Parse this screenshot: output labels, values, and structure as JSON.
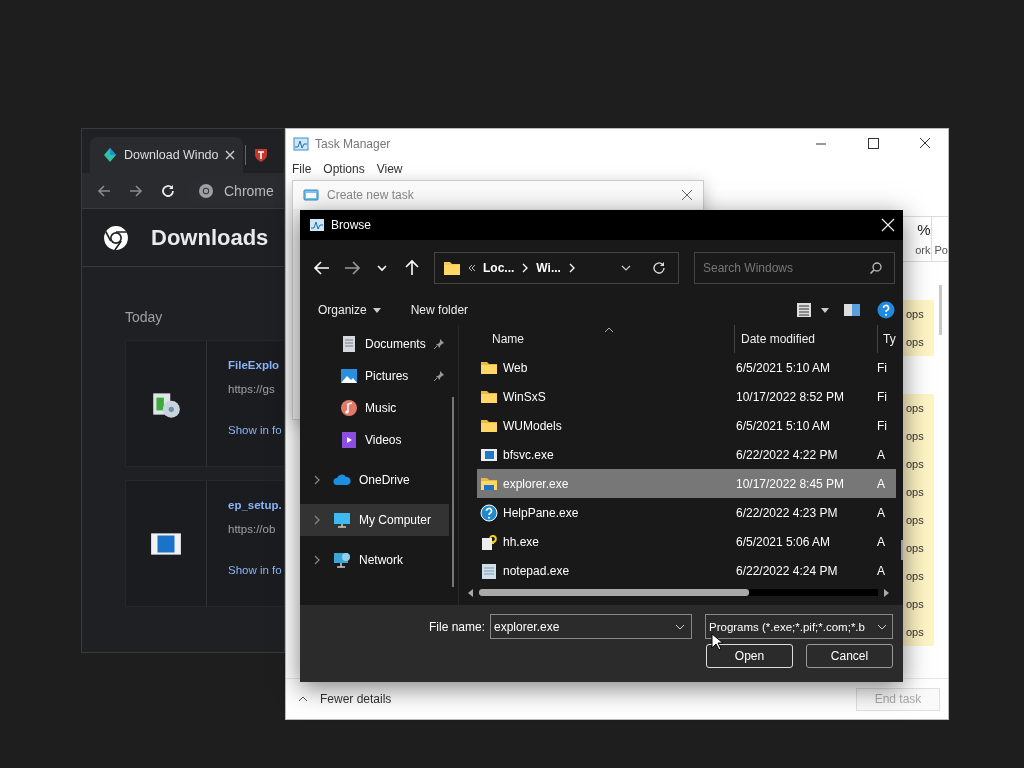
{
  "chrome": {
    "tabs": [
      {
        "title": "Download Windo",
        "selected": true
      }
    ],
    "omnibox": "Chrome",
    "page_title": "Downloads",
    "section": "Today",
    "downloads": [
      {
        "name": "FileExplo",
        "url": "https://gs",
        "action": "Show in fo",
        "kind": "installer"
      },
      {
        "name": "ep_setup.",
        "url": "https://ob",
        "action": "Show in fo",
        "kind": "app"
      }
    ]
  },
  "task_manager": {
    "title": "Task Manager",
    "menu": [
      "File",
      "Options",
      "View"
    ],
    "columns": [
      {
        "value": "%",
        "label": "ork"
      },
      {
        "label": "Po"
      }
    ],
    "groups": [
      {
        "rows": [
          "ops",
          "ops"
        ]
      },
      {
        "rows": [
          "ops",
          "ops",
          "ops",
          "ops",
          "ops",
          "ops",
          "ops",
          "ops",
          "ops"
        ]
      }
    ],
    "fewer_details": "Fewer details",
    "end_task": {
      "label": "End task",
      "disabled": true
    }
  },
  "create_task": {
    "title": "Create new task"
  },
  "browse": {
    "title": "Browse",
    "breadcrumb": [
      "Loc...",
      "Wi..."
    ],
    "search": {
      "placeholder": "Search Windows"
    },
    "commands": [
      "Organize",
      "New folder"
    ],
    "nav": [
      {
        "label": "Documents",
        "kind": "documents",
        "pinned": true,
        "selected": false
      },
      {
        "label": "Pictures",
        "kind": "pictures",
        "pinned": true,
        "selected": false
      },
      {
        "label": "Music",
        "kind": "music",
        "pinned": false,
        "selected": false
      },
      {
        "label": "Videos",
        "kind": "videos",
        "pinned": false,
        "selected": false
      },
      {
        "label": "OneDrive",
        "kind": "cloud",
        "pinned": false,
        "selected": false
      },
      {
        "label": "My Computer",
        "kind": "computer",
        "pinned": false,
        "selected": true
      },
      {
        "label": "Network",
        "kind": "network",
        "pinned": false,
        "selected": false
      }
    ],
    "columns": [
      "Name",
      "Date modified",
      "Ty"
    ],
    "files": [
      {
        "name": "Web",
        "date": "6/5/2021 5:10 AM",
        "type": "Fi",
        "kind": "folder",
        "selected": false
      },
      {
        "name": "WinSxS",
        "date": "10/17/2022 8:52 PM",
        "type": "Fi",
        "kind": "folder",
        "selected": false
      },
      {
        "name": "WUModels",
        "date": "6/5/2021 5:10 AM",
        "type": "Fi",
        "kind": "folder",
        "selected": false
      },
      {
        "name": "bfsvc.exe",
        "date": "6/22/2022 4:22 PM",
        "type": "A",
        "kind": "app",
        "selected": false
      },
      {
        "name": "explorer.exe",
        "date": "10/17/2022 8:45 PM",
        "type": "A",
        "kind": "explorer",
        "selected": true
      },
      {
        "name": "HelpPane.exe",
        "date": "6/22/2022 4:23 PM",
        "type": "A",
        "kind": "help",
        "selected": false
      },
      {
        "name": "hh.exe",
        "date": "6/5/2021 5:06 AM",
        "type": "A",
        "kind": "helpdoc",
        "selected": false
      },
      {
        "name": "notepad.exe",
        "date": "6/22/2022 4:24 PM",
        "type": "A",
        "kind": "notepad",
        "selected": false
      }
    ],
    "file_name_label": "File name:",
    "file_name": "explorer.exe",
    "filter": "Programs (*.exe;*.pif;*.com;*.b",
    "buttons": [
      "Open",
      "Cancel"
    ]
  }
}
